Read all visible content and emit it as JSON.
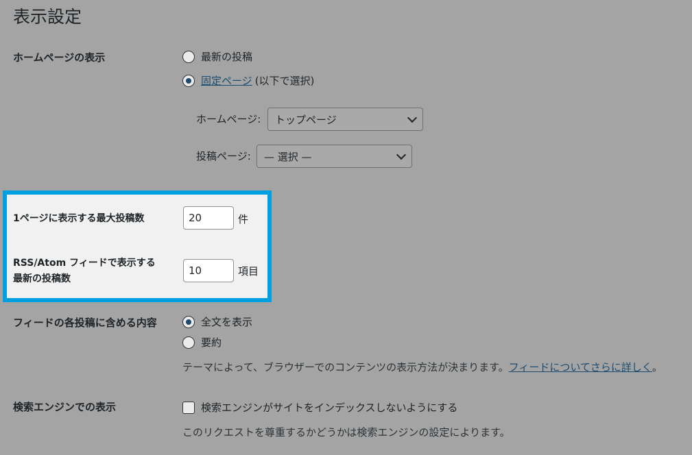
{
  "page": {
    "title": "表示設定"
  },
  "homepage_display": {
    "label": "ホームページの表示",
    "option_latest": "最新の投稿",
    "option_static_link": "固定ページ",
    "option_static_suffix": "(以下で選択)",
    "homepage_label": "ホームページ:",
    "homepage_value": "トップページ",
    "posts_page_label": "投稿ページ:",
    "posts_page_value": "— 選択 —"
  },
  "posts_per_page": {
    "label": "1ページに表示する最大投稿数",
    "value": "20",
    "unit": "件"
  },
  "rss_items": {
    "label_line1": "RSS/Atom フィードで表示する",
    "label_line2": "最新の投稿数",
    "value": "10",
    "unit": "項目"
  },
  "feed_content": {
    "label": "フィードの各投稿に含める内容",
    "option_full": "全文を表示",
    "option_summary": "要約",
    "description": "テーマによって、ブラウザーでのコンテンツの表示方法が決まります。",
    "description_link": "フィードについてさらに詳しく",
    "description_end": "。"
  },
  "search_engine": {
    "label": "検索エンジンでの表示",
    "checkbox_label": "検索エンジンがサイトをインデックスしないようにする",
    "description": "このリクエストを尊重するかどうかは検索エンジンの設定によります。"
  },
  "colors": {
    "highlight_border": "#00a0e0",
    "overlay_bg": "#a4a4a4",
    "link": "#1a4b70"
  }
}
